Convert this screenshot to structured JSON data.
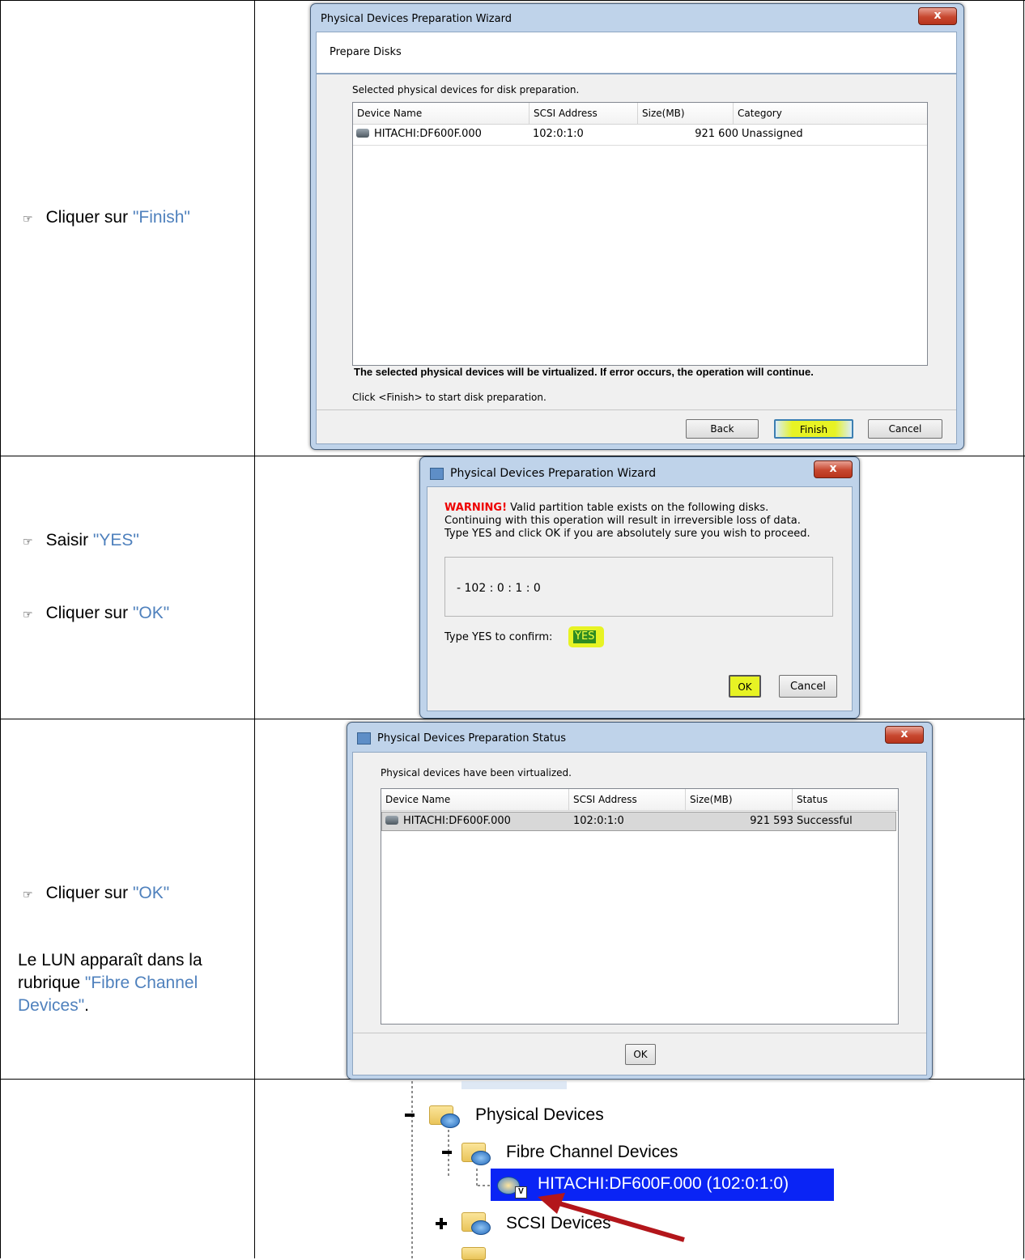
{
  "rows": [
    {
      "instructions": [
        {
          "hand": "☞",
          "prefix": "Cliquer sur ",
          "quote": "\"Finish\""
        }
      ],
      "wizard": {
        "title": "Physical Devices Preparation Wizard",
        "close": "x",
        "header": "Prepare Disks",
        "intro": "Selected physical devices for disk preparation.",
        "columns": [
          "Device Name",
          "SCSI Address",
          "Size(MB)",
          "Category"
        ],
        "rows": [
          {
            "device": "HITACHI:DF600F.000",
            "scsi": "102:0:1:0",
            "size": "921 600",
            "category": "Unassigned"
          }
        ],
        "warning": "The selected physical devices will be virtualized. If error occurs, the operation will continue.",
        "hint": "Click <Finish> to start disk preparation.",
        "buttons": {
          "back": "Back",
          "finish": "Finish",
          "cancel": "Cancel"
        }
      }
    },
    {
      "instructions": [
        {
          "hand": "☞",
          "prefix": "Saisir ",
          "quote": "\"YES\""
        },
        {
          "hand": "☞",
          "prefix": "Cliquer sur ",
          "quote": "\"OK\""
        }
      ],
      "confirm": {
        "title": "Physical Devices Preparation Wizard",
        "close": "x",
        "warning_label": "WARNING!",
        "warning_line1": " Valid partition table exists on the following disks.",
        "warning_line2": "Continuing with this operation will result in irreversible loss of data.",
        "warning_line3": "Type YES and click OK if you are absolutely sure you wish to proceed.",
        "disk_item": "- 102 : 0 : 1 : 0",
        "confirm_label": "Type YES to confirm:",
        "confirm_value": "YES",
        "ok": "OK",
        "cancel": "Cancel"
      }
    },
    {
      "instructions": [
        {
          "hand": "☞",
          "prefix": "Cliquer sur ",
          "quote": "\"OK\""
        }
      ],
      "status": {
        "title": "Physical Devices Preparation Status",
        "close": "x",
        "message": "Physical devices have been virtualized.",
        "columns": [
          "Device Name",
          "SCSI Address",
          "Size(MB)",
          "Status"
        ],
        "rows": [
          {
            "device": "HITACHI:DF600F.000",
            "scsi": "102:0:1:0",
            "size": "921 593",
            "status": "Successful"
          }
        ],
        "ok": "OK"
      }
    },
    {
      "description": {
        "prefix": "Le LUN apparaît dans la rubrique ",
        "quote": "\"Fibre Channel Devices\"",
        "suffix": "."
      },
      "tree": {
        "physical_devices": "Physical Devices",
        "fibre_channel": "Fibre Channel Devices",
        "selected_device": "HITACHI:DF600F.000 (102:0:1:0)",
        "scsi_devices": "SCSI Devices"
      }
    }
  ],
  "colors": {
    "selection": "#0a24f5",
    "highlight": "#e7f324",
    "arrow": "#b3161b",
    "link": "#4f81bd"
  }
}
